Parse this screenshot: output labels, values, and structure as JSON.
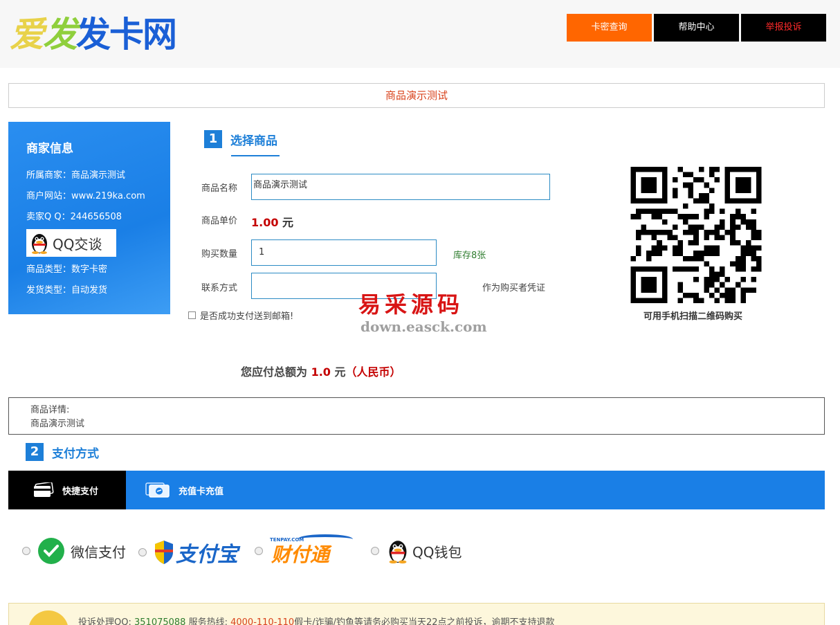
{
  "header": {
    "logo": [
      "爱",
      "发",
      "发卡网"
    ],
    "nav": [
      "卡密查询",
      "帮助中心",
      "举报投诉"
    ]
  },
  "title_bar": "商品演示测试",
  "merchant": {
    "heading": "商家信息",
    "owner": "所属商家：商品演示测试",
    "site": "商户网站：www.219ka.com",
    "qq": "卖家Q Q：244656508",
    "qq_button": "QQ交谈",
    "product_type": "商品类型：数字卡密",
    "delivery": "发货类型：自动发货"
  },
  "step1": {
    "num": "1",
    "label": "选择商品"
  },
  "form": {
    "name_label": "商品名称",
    "name_value": "商品演示测试",
    "price_label": "商品单价",
    "price_value": "1.00",
    "price_unit": " 元",
    "qty_label": "购买数量",
    "qty_value": "1",
    "stock": "库存8张",
    "contact_label": "联系方式",
    "contact_note": "作为购买者凭证",
    "email_check": "是否成功支付送到邮箱!"
  },
  "watermark": {
    "cn": "易采源码",
    "url": "down.easck.com"
  },
  "qr_caption": "可用手机扫描二维码购买",
  "total": {
    "prefix": "您应付总额为 ",
    "amount": "1.0",
    "unit": " 元",
    "currency": "（人民币）"
  },
  "details": {
    "label": "商品详情:",
    "text": "商品演示测试"
  },
  "step2": {
    "num": "2",
    "label": "支付方式"
  },
  "pay_tabs": [
    "快捷支付",
    "充值卡充值"
  ],
  "pay_options": {
    "wechat": "微信支付",
    "alipay": "支付宝",
    "tenpay_small": "TENPAY.COM",
    "tenpay": "财付通",
    "qqwallet": "QQ钱包"
  },
  "notice": {
    "a": "投诉处理QQ:",
    "qq": "351075088",
    "b": " 服务热线:",
    "tel": "4000-110-110",
    "c": "假卡/诈骗/钓鱼等请务必购买当天22点之前投诉，逾期不支持退款"
  },
  "colors": {
    "primary_blue": "#1a7fe6",
    "orange": "#ff6600",
    "price_red": "#c40000"
  }
}
